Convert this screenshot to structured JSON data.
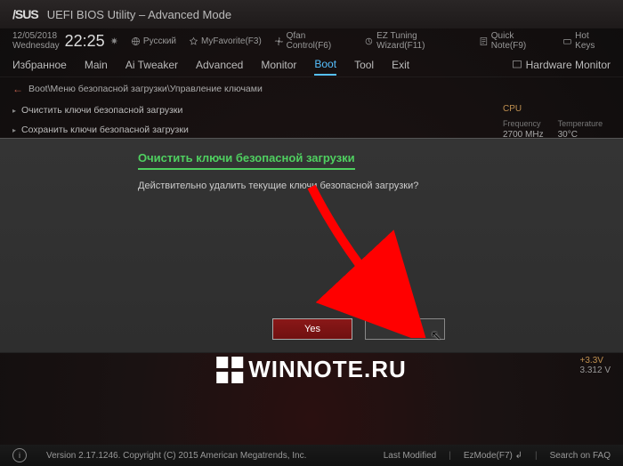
{
  "titlebar": {
    "logo": "/SUS",
    "title": "UEFI BIOS Utility – Advanced Mode"
  },
  "clock": {
    "date": "12/05/2018",
    "day": "Wednesday",
    "time": "22:25",
    "gear": "✷"
  },
  "toplinks": {
    "lang": "Русский",
    "fav": "MyFavorite(F3)",
    "qfan": "Qfan Control(F6)",
    "ez": "EZ Tuning Wizard(F11)",
    "note": "Quick Note(F9)",
    "hot": "Hot Keys"
  },
  "menu": {
    "items": [
      "Избранное",
      "Main",
      "Ai Tweaker",
      "Advanced",
      "Monitor",
      "Boot",
      "Tool",
      "Exit"
    ],
    "active": 5,
    "hwmon": "Hardware Monitor"
  },
  "breadcrumb": "Boot\\Меню безопасной загрузки\\Управление ключами",
  "options": [
    "Очистить ключи безопасной загрузки",
    "Сохранить ключи безопасной загрузки"
  ],
  "sidebar": {
    "cpu_label": "CPU",
    "freq_label": "Frequency",
    "freq_val": "2700 MHz",
    "temp_label": "Temperature",
    "temp_val": "30°C",
    "volt_label": "+3.3V",
    "volt_val": "3.312 V"
  },
  "dialog": {
    "title": "Очистить ключи безопасной загрузки",
    "body": "Действительно удалить текущие ключи безопасной загрузки?",
    "yes": "Yes",
    "no": "No"
  },
  "watermark": "WINNOTE.RU",
  "bottom": {
    "version": "Version 2.17.1246. Copyright (C) 2015 American Megatrends, Inc.",
    "last": "Last Modified",
    "ezmode": "EzMode(F7)",
    "faq": "Search on FAQ"
  }
}
